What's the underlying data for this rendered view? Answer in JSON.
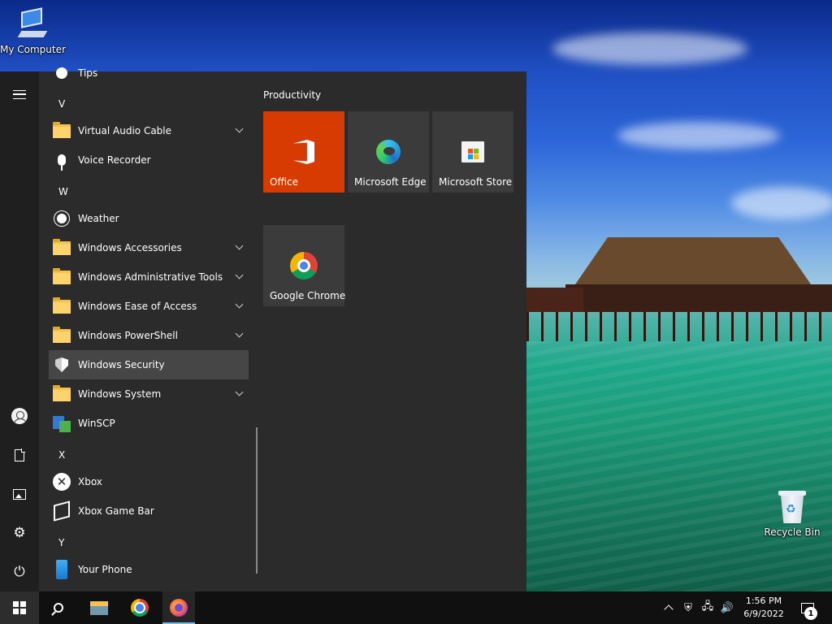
{
  "desktop": {
    "icons": {
      "my_computer": "My Computer",
      "recycle_bin": "Recycle Bin"
    }
  },
  "rail": {
    "items": [
      "menu-icon",
      "user-icon",
      "documents-icon",
      "pictures-icon",
      "settings-icon",
      "power-icon"
    ]
  },
  "app_list": {
    "tips": "Tips",
    "letters": {
      "v": "V",
      "w": "W",
      "x": "X",
      "y": "Y"
    },
    "apps": {
      "virtual_audio_cable": "Virtual Audio Cable",
      "voice_recorder": "Voice Recorder",
      "weather": "Weather",
      "windows_accessories": "Windows Accessories",
      "windows_admin_tools": "Windows Administrative Tools",
      "windows_ease_of_access": "Windows Ease of Access",
      "windows_powershell": "Windows PowerShell",
      "windows_security": "Windows Security",
      "windows_system": "Windows System",
      "winscp": "WinSCP",
      "xbox": "Xbox",
      "xbox_game_bar": "Xbox Game Bar",
      "your_phone": "Your Phone"
    },
    "selected": "Windows Security"
  },
  "tiles": {
    "group_title": "Productivity",
    "office": "Office",
    "edge": "Microsoft Edge",
    "store": "Microsoft Store",
    "chrome": "Google Chrome"
  },
  "taskbar": {
    "time": "1:56 PM",
    "date": "6/9/2022",
    "notification_count": "1",
    "pinned": [
      "file-explorer",
      "google-chrome",
      "firefox"
    ]
  },
  "colors": {
    "office_tile": "#d83b01",
    "start_menu_bg": "#2b2b2b",
    "rail_bg": "#1f1f1f",
    "taskbar_bg": "#101010",
    "selected_row": "#464646"
  }
}
